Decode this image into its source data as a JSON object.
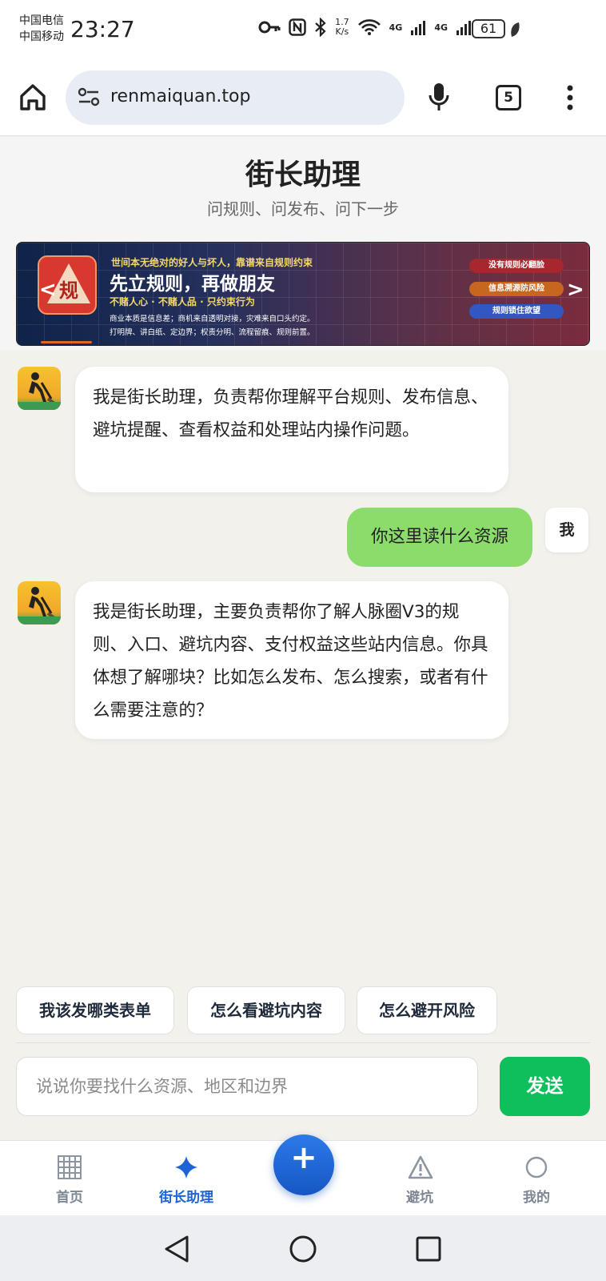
{
  "status_bar": {
    "carrier1": "中国电信",
    "carrier2": "中国移动",
    "time": "23:27",
    "speed_value": "1.7",
    "speed_unit": "K/s",
    "net1": "4G",
    "net2": "4G",
    "battery": "61"
  },
  "browser": {
    "url": "renmaiquan.top",
    "tab_count": "5"
  },
  "header": {
    "title": "街长助理",
    "subtitle": "问规则、问发布、问下一步"
  },
  "banner": {
    "badge_char": "规",
    "tagline": "世间本无绝对的好人与坏人，靠谱来自规则约束",
    "headline": "先立规则，再做朋友",
    "sub": "不赌人心 · 不赌人品 · 只约束行为",
    "line1": "商业本质是信息差；商机来自透明对接，灾难来自口头约定。",
    "line2": "打明牌、讲白纸、定边界；权责分明、流程留痕、规则前置。",
    "pills": [
      "没有规则必翻脸",
      "信息溯源防风险",
      "规则锁住欲望"
    ],
    "prev_arrow": "<",
    "next_arrow": ">"
  },
  "chat": {
    "messages": [
      {
        "role": "assistant",
        "text": "我是街长助理，负责帮你理解平台规则、发布信息、避坑提醒、查看权益和处理站内操作问题。"
      },
      {
        "role": "user",
        "text": "你这里读什么资源",
        "tag": "我"
      },
      {
        "role": "assistant",
        "text": "我是街长助理，主要负责帮你了解人脉圈V3的规则、入口、避坑内容、支付权益这些站内信息。你具体想了解哪块？比如怎么发布、怎么搜索，或者有什么需要注意的？"
      }
    ]
  },
  "quick_replies": [
    "我该发哪类表单",
    "怎么看避坑内容",
    "怎么避开风险"
  ],
  "input": {
    "placeholder": "说说你要找什么资源、地区和边界",
    "value": ""
  },
  "send_label": "发送",
  "bottom_nav": {
    "items": [
      {
        "label": "首页",
        "icon": "grid-icon"
      },
      {
        "label": "街长助理",
        "icon": "sparkle-icon",
        "active": true
      },
      {
        "label": "避坑",
        "icon": "warning-icon"
      },
      {
        "label": "我的",
        "icon": "profile-icon"
      }
    ],
    "fab_label": "+"
  },
  "colors": {
    "accent": "#1d63d3",
    "user_bubble": "#8bdc6b",
    "send_button": "#0fbf5c"
  }
}
